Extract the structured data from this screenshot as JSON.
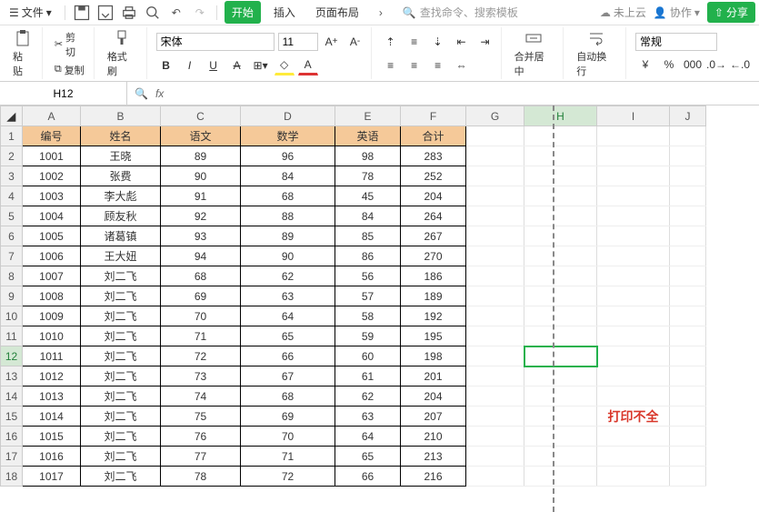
{
  "menu": {
    "file": "文件",
    "tabs": [
      "开始",
      "插入",
      "页面布局"
    ],
    "activeTab": 0,
    "search_placeholder": "查找命令、搜索模板",
    "cloud": "未上云",
    "collab": "协作",
    "share": "分享"
  },
  "toolbar": {
    "paste": "粘贴",
    "cut": "剪切",
    "copy": "复制",
    "format_painter": "格式刷",
    "font_name": "宋体",
    "font_size": "11",
    "merge": "合并居中",
    "wrap": "自动换行",
    "number_format": "常规"
  },
  "name_box": "H12",
  "columns": [
    "A",
    "B",
    "C",
    "D",
    "E",
    "F",
    "G",
    "H",
    "I",
    "J"
  ],
  "headers": [
    "编号",
    "姓名",
    "语文",
    "数学",
    "英语",
    "合计"
  ],
  "rows": [
    {
      "n": 2,
      "c": [
        "1001",
        "王晓",
        "89",
        "96",
        "98",
        "283"
      ]
    },
    {
      "n": 3,
      "c": [
        "1002",
        "张费",
        "90",
        "84",
        "78",
        "252"
      ]
    },
    {
      "n": 4,
      "c": [
        "1003",
        "李大彪",
        "91",
        "68",
        "45",
        "204"
      ]
    },
    {
      "n": 5,
      "c": [
        "1004",
        "顾友秋",
        "92",
        "88",
        "84",
        "264"
      ]
    },
    {
      "n": 6,
      "c": [
        "1005",
        "诸葛镇",
        "93",
        "89",
        "85",
        "267"
      ]
    },
    {
      "n": 7,
      "c": [
        "1006",
        "王大妞",
        "94",
        "90",
        "86",
        "270"
      ]
    },
    {
      "n": 8,
      "c": [
        "1007",
        "刘二飞",
        "68",
        "62",
        "56",
        "186"
      ]
    },
    {
      "n": 9,
      "c": [
        "1008",
        "刘二飞",
        "69",
        "63",
        "57",
        "189"
      ]
    },
    {
      "n": 10,
      "c": [
        "1009",
        "刘二飞",
        "70",
        "64",
        "58",
        "192"
      ]
    },
    {
      "n": 11,
      "c": [
        "1010",
        "刘二飞",
        "71",
        "65",
        "59",
        "195"
      ]
    },
    {
      "n": 12,
      "c": [
        "1011",
        "刘二飞",
        "72",
        "66",
        "60",
        "198"
      ]
    },
    {
      "n": 13,
      "c": [
        "1012",
        "刘二飞",
        "73",
        "67",
        "61",
        "201"
      ]
    },
    {
      "n": 14,
      "c": [
        "1013",
        "刘二飞",
        "74",
        "68",
        "62",
        "204"
      ]
    },
    {
      "n": 15,
      "c": [
        "1014",
        "刘二飞",
        "75",
        "69",
        "63",
        "207"
      ]
    },
    {
      "n": 16,
      "c": [
        "1015",
        "刘二飞",
        "76",
        "70",
        "64",
        "210"
      ]
    },
    {
      "n": 17,
      "c": [
        "1016",
        "刘二飞",
        "77",
        "71",
        "65",
        "213"
      ]
    },
    {
      "n": 18,
      "c": [
        "1017",
        "刘二飞",
        "78",
        "72",
        "66",
        "216"
      ]
    }
  ],
  "selected_cell": {
    "row": 12,
    "col": "H"
  },
  "annotation": "打印不全"
}
